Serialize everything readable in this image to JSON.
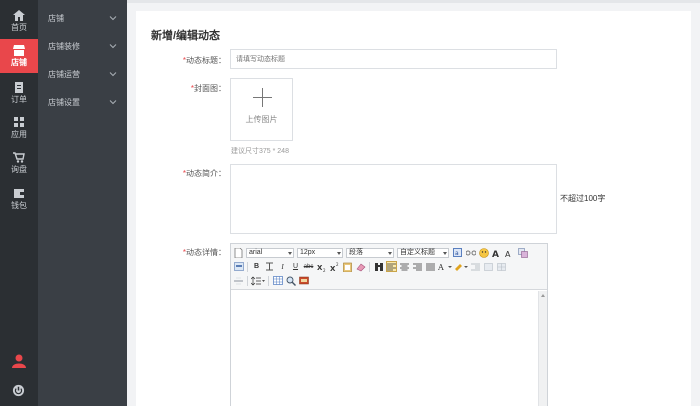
{
  "rail": {
    "items": [
      {
        "label": "首页",
        "icon": "home-icon"
      },
      {
        "label": "店铺",
        "icon": "store-icon",
        "active": true
      },
      {
        "label": "订单",
        "icon": "order-icon"
      },
      {
        "label": "应用",
        "icon": "apps-icon"
      },
      {
        "label": "询盘",
        "icon": "cart-icon"
      },
      {
        "label": "钱包",
        "icon": "wallet-icon"
      }
    ],
    "bottom_icons": [
      "user-icon",
      "power-icon"
    ],
    "accent": "#e9474b"
  },
  "submenu": {
    "items": [
      {
        "label": "店铺"
      },
      {
        "label": "店铺装修"
      },
      {
        "label": "店铺运营"
      },
      {
        "label": "店铺设置"
      }
    ]
  },
  "form": {
    "page_title": "新增/编辑动态",
    "title_label": "动态标题：",
    "title_placeholder": "请填写动态标题",
    "cover_label": "封面图：",
    "upload_text": "上传图片",
    "cover_hint": "建议尺寸375 * 248",
    "intro_label": "动态简介：",
    "intro_limit": "不超过100字",
    "detail_label": "动态详情：",
    "required_mark": "*"
  },
  "editor": {
    "font_family": "arial",
    "font_size": "12px",
    "paragraph": "段落",
    "custom_title": "自定义标题"
  }
}
